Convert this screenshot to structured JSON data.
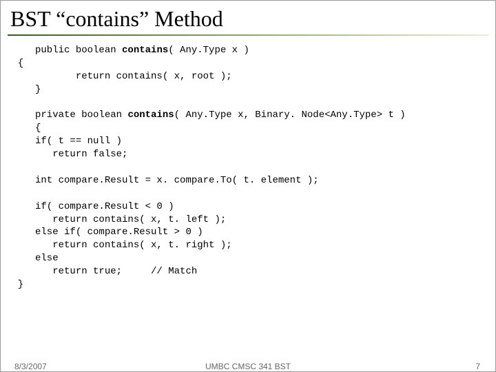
{
  "title": "BST “contains” Method",
  "code": {
    "l1a": "     public boolean ",
    "l1b": "contains",
    "l1c": "( Any.Type x )",
    "l2": "  {",
    "l3": "            return contains( x, root );",
    "l4": "     }",
    "blank1": "",
    "l5a": "     private boolean ",
    "l5b": "contains",
    "l5c": "( Any.Type x, Binary. Node<Any.Type> t )",
    "l6": "     {",
    "l7": "     if( t == null )",
    "l8": "        return false;",
    "blank2": "",
    "l9": "     int compare.Result = x. compare.To( t. element );",
    "blank3": "",
    "l10": "     if( compare.Result < 0 )",
    "l11": "        return contains( x, t. left );",
    "l12": "     else if( compare.Result > 0 )",
    "l13": "        return contains( x, t. right );",
    "l14": "     else",
    "l15": "        return true;     // Match",
    "l16": "  }"
  },
  "footer": {
    "date": "8/3/2007",
    "course": "UMBC CMSC 341 BST",
    "pagenum": "7"
  }
}
